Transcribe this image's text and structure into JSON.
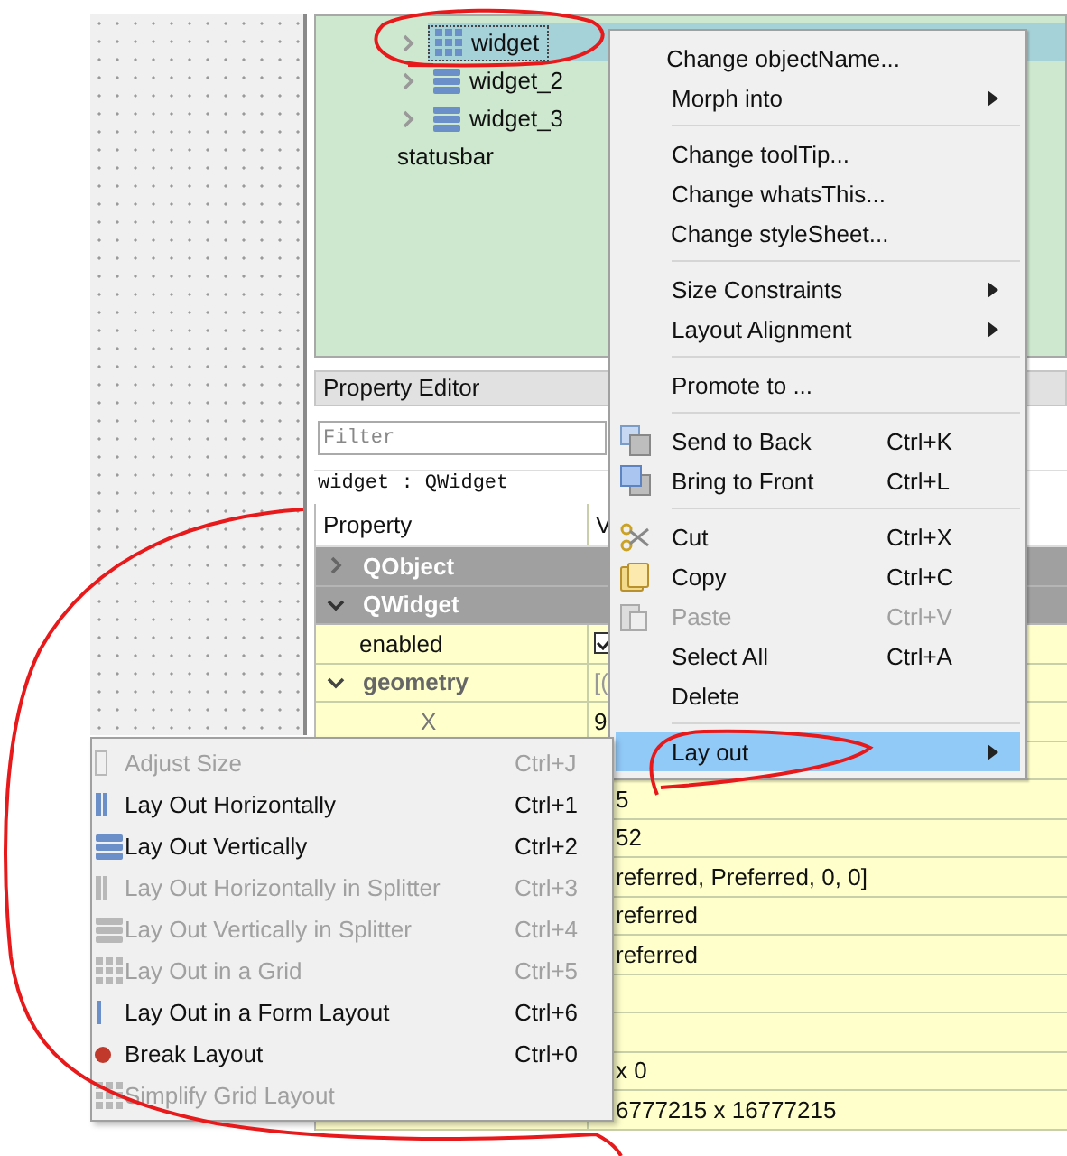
{
  "object_tree": [
    {
      "label": "widget",
      "selected": true,
      "expandable": true
    },
    {
      "label": "widget_2",
      "selected": false,
      "expandable": true
    },
    {
      "label": "widget_3",
      "selected": false,
      "expandable": true
    },
    {
      "label": "statusbar",
      "selected": false,
      "expandable": false
    }
  ],
  "property_editor": {
    "title": "Property Editor",
    "filter": {
      "placeholder": "Filter"
    },
    "object_label": "widget : QWidget",
    "columns": [
      "Property",
      "V"
    ],
    "rows": [
      {
        "kind": "group",
        "name": "QObject",
        "expanded": false
      },
      {
        "kind": "group",
        "name": "QWidget",
        "expanded": true
      },
      {
        "kind": "checkbox_property",
        "name": "enabled",
        "checked": true
      },
      {
        "kind": "parent",
        "name": "geometry",
        "expanded": true,
        "value": "[("
      },
      {
        "kind": "sub",
        "name": "X",
        "value": "9"
      },
      {
        "kind": "blank"
      },
      {
        "kind": "value_row",
        "value": "5"
      },
      {
        "kind": "value_row",
        "value": "52"
      },
      {
        "kind": "value_row",
        "value": "referred, Preferred, 0, 0]"
      },
      {
        "kind": "value_row",
        "value": "referred"
      },
      {
        "kind": "value_row",
        "value": "referred"
      },
      {
        "kind": "blank"
      },
      {
        "kind": "blank"
      },
      {
        "kind": "value_row",
        "value": "x 0"
      },
      {
        "kind": "value_row",
        "value": "6777215 x 16777215"
      }
    ]
  },
  "context_menu": [
    {
      "kind": "item",
      "label": "Change objectName...",
      "submenu": false,
      "disabled": false,
      "selected": false
    },
    {
      "kind": "item",
      "label": "Morph into",
      "submenu": true,
      "disabled": false,
      "selected": false
    },
    {
      "kind": "separator"
    },
    {
      "kind": "item",
      "label": "Change toolTip...",
      "submenu": false,
      "disabled": false,
      "selected": false
    },
    {
      "kind": "item",
      "label": "Change whatsThis...",
      "submenu": false,
      "disabled": false,
      "selected": false
    },
    {
      "kind": "item",
      "label": "Change styleSheet...",
      "submenu": false,
      "disabled": false,
      "selected": false
    },
    {
      "kind": "separator"
    },
    {
      "kind": "item",
      "label": "Size Constraints",
      "submenu": true,
      "disabled": false,
      "selected": false
    },
    {
      "kind": "item",
      "label": "Layout Alignment",
      "submenu": true,
      "disabled": false,
      "selected": false
    },
    {
      "kind": "separator"
    },
    {
      "kind": "item",
      "label": "Promote to ...",
      "submenu": false,
      "disabled": false,
      "selected": false
    },
    {
      "kind": "separator"
    },
    {
      "kind": "item",
      "label": "Send to Back",
      "shortcut": "Ctrl+K",
      "submenu": false,
      "disabled": false,
      "selected": false
    },
    {
      "kind": "item",
      "label": "Bring to Front",
      "shortcut": "Ctrl+L",
      "submenu": false,
      "disabled": false,
      "selected": false
    },
    {
      "kind": "separator"
    },
    {
      "kind": "item",
      "label": "Cut",
      "shortcut": "Ctrl+X",
      "submenu": false,
      "disabled": false,
      "selected": false
    },
    {
      "kind": "item",
      "label": "Copy",
      "shortcut": "Ctrl+C",
      "submenu": false,
      "disabled": false,
      "selected": false
    },
    {
      "kind": "item",
      "label": "Paste",
      "shortcut": "Ctrl+V",
      "submenu": false,
      "disabled": true,
      "selected": false
    },
    {
      "kind": "item",
      "label": "Select All",
      "shortcut": "Ctrl+A",
      "submenu": false,
      "disabled": false,
      "selected": false
    },
    {
      "kind": "item",
      "label": "Delete",
      "submenu": false,
      "disabled": false,
      "selected": false
    },
    {
      "kind": "separator"
    },
    {
      "kind": "item",
      "label": "Lay out",
      "submenu": true,
      "disabled": false,
      "selected": true
    }
  ],
  "layout_submenu": [
    {
      "label": "Adjust Size",
      "shortcut": "Ctrl+J",
      "disabled": true,
      "selected": false
    },
    {
      "label": "Lay Out Horizontally",
      "shortcut": "Ctrl+1",
      "disabled": false,
      "selected": false
    },
    {
      "label": "Lay Out Vertically",
      "shortcut": "Ctrl+2",
      "disabled": false,
      "selected": false
    },
    {
      "label": "Lay Out Horizontally in Splitter",
      "shortcut": "Ctrl+3",
      "disabled": true,
      "selected": false
    },
    {
      "label": "Lay Out Vertically in Splitter",
      "shortcut": "Ctrl+4",
      "disabled": true,
      "selected": false
    },
    {
      "label": "Lay Out in a Grid",
      "shortcut": "Ctrl+5",
      "disabled": true,
      "selected": false
    },
    {
      "label": "Lay Out in a Form Layout",
      "shortcut": "Ctrl+6",
      "disabled": false,
      "selected": false
    },
    {
      "label": "Break Layout",
      "shortcut": "Ctrl+0",
      "disabled": false,
      "selected": false
    },
    {
      "label": "Simplify Grid Layout",
      "disabled": true,
      "selected": false
    }
  ]
}
